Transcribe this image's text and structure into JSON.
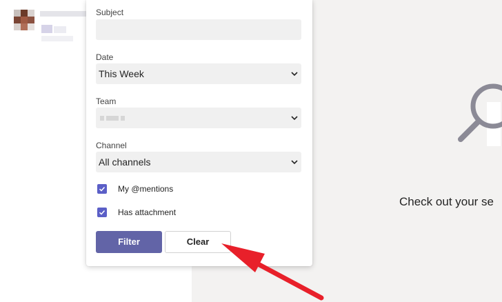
{
  "filter": {
    "subject_label": "Subject",
    "subject_value": "",
    "date_label": "Date",
    "date_value": "This Week",
    "team_label": "Team",
    "channel_label": "Channel",
    "channel_value": "All channels",
    "mentions_label": "My @mentions",
    "mentions_checked": true,
    "attachment_label": "Has attachment",
    "attachment_checked": true,
    "filter_button": "Filter",
    "clear_button": "Clear"
  },
  "empty_state": {
    "title": "Check out your se"
  },
  "colors": {
    "accent": "#6264a7",
    "checkbox": "#5b5fc7",
    "annotation": "#e8202a"
  }
}
